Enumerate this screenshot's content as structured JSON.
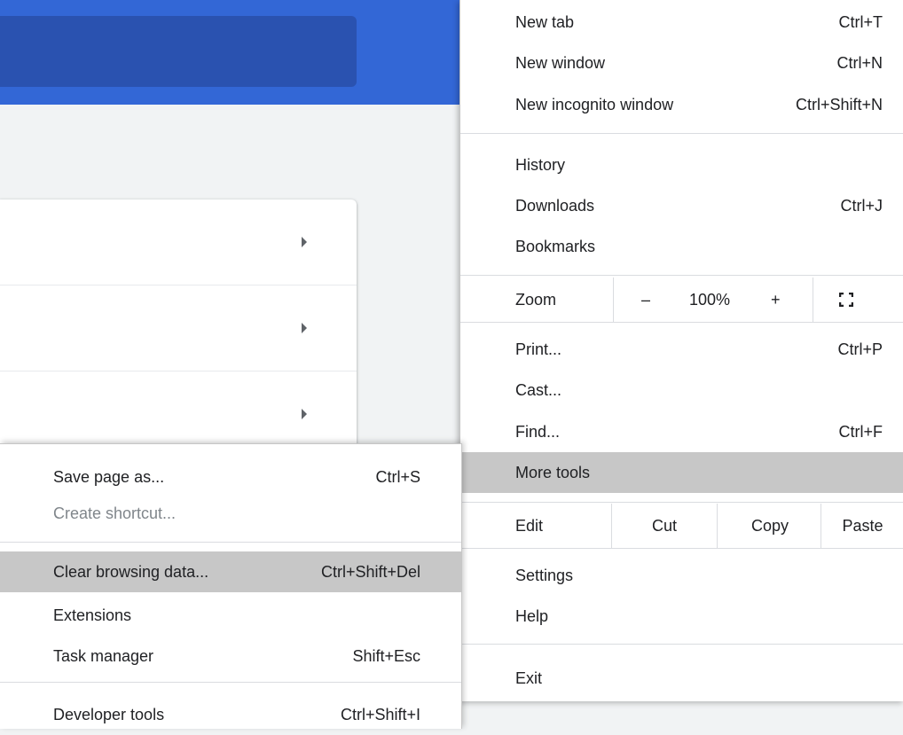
{
  "menu": {
    "new_tab": {
      "label": "New tab",
      "shortcut": "Ctrl+T"
    },
    "new_window": {
      "label": "New window",
      "shortcut": "Ctrl+N"
    },
    "new_incognito": {
      "label": "New incognito window",
      "shortcut": "Ctrl+Shift+N"
    },
    "history": {
      "label": "History"
    },
    "downloads": {
      "label": "Downloads",
      "shortcut": "Ctrl+J"
    },
    "bookmarks": {
      "label": "Bookmarks"
    },
    "zoom": {
      "label": "Zoom",
      "minus": "–",
      "value": "100%",
      "plus": "+"
    },
    "print": {
      "label": "Print...",
      "shortcut": "Ctrl+P"
    },
    "cast": {
      "label": "Cast..."
    },
    "find": {
      "label": "Find...",
      "shortcut": "Ctrl+F"
    },
    "more_tools": {
      "label": "More tools"
    },
    "edit": {
      "label": "Edit",
      "cut": "Cut",
      "copy": "Copy",
      "paste": "Paste"
    },
    "settings": {
      "label": "Settings"
    },
    "help": {
      "label": "Help"
    },
    "exit": {
      "label": "Exit"
    }
  },
  "submenu": {
    "save_page": {
      "label": "Save page as...",
      "shortcut": "Ctrl+S"
    },
    "create_shortcut": {
      "label": "Create shortcut..."
    },
    "clear_browsing": {
      "label": "Clear browsing data...",
      "shortcut": "Ctrl+Shift+Del"
    },
    "extensions": {
      "label": "Extensions"
    },
    "task_manager": {
      "label": "Task manager",
      "shortcut": "Shift+Esc"
    },
    "developer_tools": {
      "label": "Developer tools",
      "shortcut": "Ctrl+Shift+I"
    }
  },
  "colors": {
    "header": "#3367d6",
    "search_box": "#2a52b0",
    "highlight": "#c7c7c7"
  },
  "icons": {
    "fullscreen": "fullscreen-icon",
    "card_arrow": "chevron-right-icon"
  }
}
